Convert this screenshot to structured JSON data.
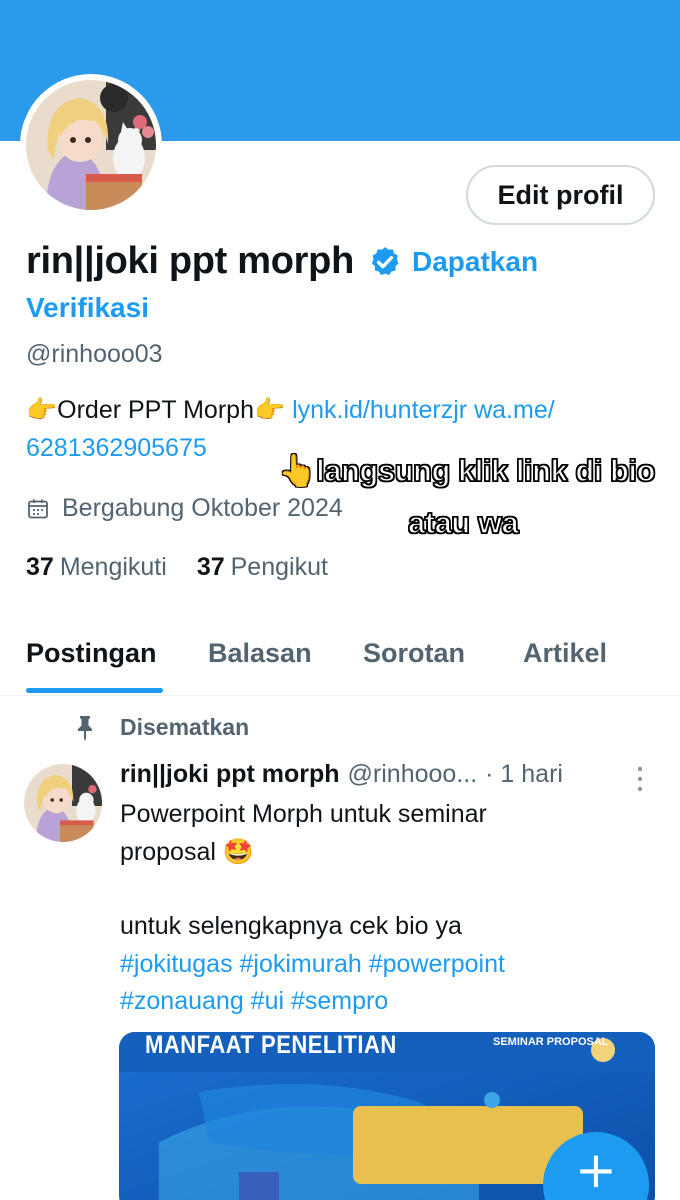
{
  "profile": {
    "edit_button": "Edit profil",
    "display_name": "rin||joki ppt morph",
    "get_verified_1": "Dapatkan",
    "get_verified_2": "Verifikasi",
    "handle": "@rinhooo03",
    "bio_text": "Order PPT Morph",
    "bio_link_1": "lynk.id/hunterzjr",
    "bio_link_2": "wa.me/",
    "bio_link_3": "6281362905675",
    "joined": "Bergabung Oktober 2024",
    "following_count": "37",
    "following_label": "Mengikuti",
    "followers_count": "37",
    "followers_label": "Pengikut"
  },
  "overlay": {
    "line1": "langsung klik link di bio",
    "line2": "atau wa"
  },
  "tabs": [
    {
      "label": "Postingan",
      "active": true
    },
    {
      "label": "Balasan",
      "active": false
    },
    {
      "label": "Sorotan",
      "active": false
    },
    {
      "label": "Artikel",
      "active": false
    }
  ],
  "pinned": {
    "label": "Disematkan",
    "name": "rin||joki ppt morph",
    "handle": "@rinhooo...",
    "time": "· 1 hari",
    "text_line1": "Powerpoint Morph untuk seminar",
    "text_line2": "proposal",
    "text_line3": "untuk selengkapnya cek bio ya",
    "hashtags_line1": "#jokitugas #jokimurah #powerpoint",
    "hashtags_line2": "#zonauang #ui #sempro",
    "media_title": "MANFAAT PENELITIAN",
    "media_subtitle": "SEMINAR PROPOSAL"
  },
  "icons": {
    "verified": "verified-badge-icon",
    "calendar": "calendar-icon",
    "pin": "pin-icon",
    "more": "more-vertical-icon",
    "compose": "plus-icon"
  },
  "colors": {
    "banner": "#2b9ae8",
    "accent": "#1d9bf0",
    "text": "#0f1419",
    "muted": "#536471"
  }
}
